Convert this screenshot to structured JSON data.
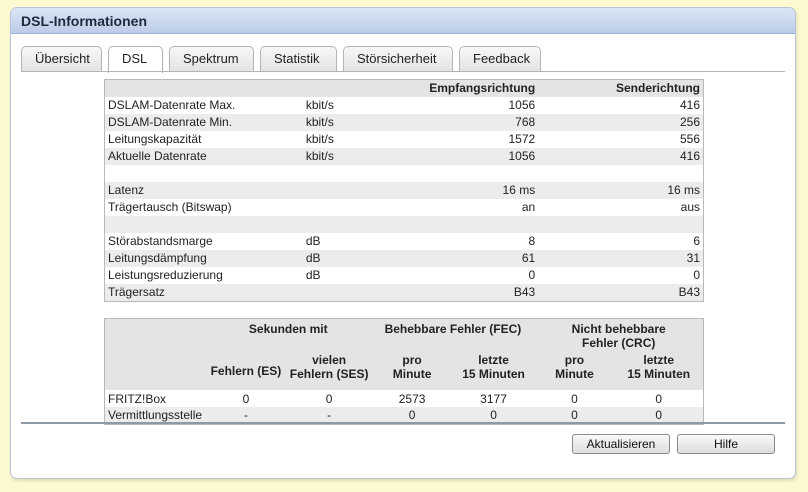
{
  "panel": {
    "title": "DSL-Informationen"
  },
  "tabs": [
    {
      "label": "Übersicht",
      "active": false
    },
    {
      "label": "DSL",
      "active": true
    },
    {
      "label": "Spektrum",
      "active": false
    },
    {
      "label": "Statistik",
      "active": false
    },
    {
      "label": "Störsicherheit",
      "active": false
    },
    {
      "label": "Feedback",
      "active": false
    }
  ],
  "rates_table": {
    "header": {
      "rx": "Empfangsrichtung",
      "tx": "Senderichtung"
    },
    "rows": [
      {
        "label": "DSLAM-Datenrate Max.",
        "unit": "kbit/s",
        "rx": "1056",
        "tx": "416"
      },
      {
        "label": "DSLAM-Datenrate Min.",
        "unit": "kbit/s",
        "rx": "768",
        "tx": "256"
      },
      {
        "label": "Leitungskapazität",
        "unit": "kbit/s",
        "rx": "1572",
        "tx": "556"
      },
      {
        "label": "Aktuelle Datenrate",
        "unit": "kbit/s",
        "rx": "1056",
        "tx": "416"
      },
      {
        "label": "",
        "unit": "",
        "rx": "",
        "tx": ""
      },
      {
        "label": "Latenz",
        "unit": "",
        "rx": "16 ms",
        "tx": "16 ms"
      },
      {
        "label": "Trägertausch (Bitswap)",
        "unit": "",
        "rx": "an",
        "tx": "aus"
      },
      {
        "label": "",
        "unit": "",
        "rx": "",
        "tx": ""
      },
      {
        "label": "Störabstandsmarge",
        "unit": "dB",
        "rx": "8",
        "tx": "6"
      },
      {
        "label": "Leitungsdämpfung",
        "unit": "dB",
        "rx": "61",
        "tx": "31"
      },
      {
        "label": "Leistungsreduzierung",
        "unit": "dB",
        "rx": "0",
        "tx": "0"
      },
      {
        "label": "Trägersatz",
        "unit": "",
        "rx": "B43",
        "tx": "B43"
      }
    ]
  },
  "errors_table": {
    "group_seconds": "Sekunden mit",
    "group_fec": "Behebbare Fehler (FEC)",
    "group_crc": "Nicht behebbare Fehler (CRC)",
    "es_label": "Fehlern (ES)",
    "ses_label_1": "vielen",
    "ses_label_2": "Fehlern (SES)",
    "pro_label": "pro",
    "minute_label": "Minute",
    "last_label": "letzte",
    "last15_label": "15 Minuten",
    "rows": [
      {
        "label": "FRITZ!Box",
        "es": "0",
        "ses": "0",
        "fec_min": "2573",
        "fec_15": "3177",
        "crc_min": "0",
        "crc_15": "0"
      },
      {
        "label": "Vermittlungsstelle",
        "es": "-",
        "ses": "-",
        "fec_min": "0",
        "fec_15": "0",
        "crc_min": "0",
        "crc_15": "0"
      }
    ]
  },
  "buttons": {
    "refresh": "Aktualisieren",
    "help": "Hilfe"
  }
}
